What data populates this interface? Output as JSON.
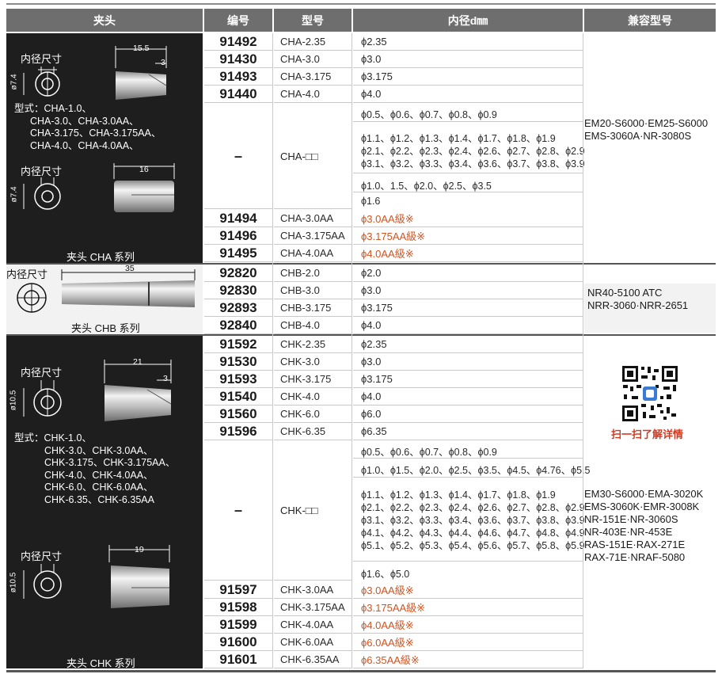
{
  "headers": {
    "collet": "夹头",
    "number": "编号",
    "model": "型号",
    "diameter": "内径d㎜",
    "compatible": "兼容型号"
  },
  "placeholder_dash": "–",
  "cha": {
    "inner_label": "内径尺寸",
    "dim_phi": "ø7.4",
    "dim_length_top": "15.5",
    "dim_small": "3",
    "dim_length_bottom": "16",
    "types_lines": [
      "型式：CHA-1.0、",
      "CHA-3.0、CHA-3.0AA、",
      "CHA-3.175、CHA-3.175AA、",
      "CHA-4.0、CHA-4.0AA、"
    ],
    "series": "夹头 CHA 系列",
    "rows_top": [
      {
        "num": "91492",
        "model": "CHA-2.35",
        "dia": "ϕ2.35"
      },
      {
        "num": "91430",
        "model": "CHA-3.0",
        "dia": "ϕ3.0"
      },
      {
        "num": "91493",
        "model": "CHA-3.175",
        "dia": "ϕ3.175"
      },
      {
        "num": "91440",
        "model": "CHA-4.0",
        "dia": "ϕ4.0"
      }
    ],
    "generic_model": "CHA-□□",
    "generic_lines": [
      "ϕ0.5、ϕ0.6、ϕ0.7、ϕ0.8、ϕ0.9",
      "ϕ1.1、ϕ1.2、ϕ1.3、ϕ1.4、ϕ1.7、ϕ1.8、ϕ1.9",
      "ϕ2.1、ϕ2.2、ϕ2.3、ϕ2.4、ϕ2.6、ϕ2.7、ϕ2.8、ϕ2.9",
      "ϕ3.1、ϕ3.2、ϕ3.3、ϕ3.4、ϕ3.6、ϕ3.7、ϕ3.8、ϕ3.9",
      "ϕ1.0、1.5、ϕ2.0、ϕ2.5、ϕ3.5",
      "ϕ1.6"
    ],
    "rows_aa": [
      {
        "num": "91494",
        "model": "CHA-3.0AA",
        "dia": "ϕ3.0AA級※"
      },
      {
        "num": "91496",
        "model": "CHA-3.175AA",
        "dia": "ϕ3.175AA級※"
      },
      {
        "num": "91495",
        "model": "CHA-4.0AA",
        "dia": "ϕ4.0AA級※"
      }
    ],
    "compatible": [
      "EM20-S6000·EM25-S6000",
      "EMS-3060A·NR-3080S"
    ]
  },
  "chb": {
    "inner_label": "内径尺寸",
    "dim_length": "35",
    "series": "夹头 CHB 系列",
    "rows": [
      {
        "num": "92820",
        "model": "CHB-2.0",
        "dia": "ϕ2.0"
      },
      {
        "num": "92830",
        "model": "CHB-3.0",
        "dia": "ϕ3.0"
      },
      {
        "num": "92893",
        "model": "CHB-3.175",
        "dia": "ϕ3.175"
      },
      {
        "num": "92840",
        "model": "CHB-4.0",
        "dia": "ϕ4.0"
      }
    ],
    "compatible": [
      "NR40-5100  ATC",
      "NRR-3060·NRR-2651"
    ]
  },
  "chk": {
    "inner_label": "内径尺寸",
    "dim_phi": "ø10.5",
    "dim_length_top": "21",
    "dim_small": "3",
    "dim_length_bottom": "19",
    "types_lines": [
      "型式：CHK-1.0、",
      "CHK-3.0、CHK-3.0AA、",
      "CHK-3.175、CHK-3.175AA、",
      "CHK-4.0、CHK-4.0AA、",
      "CHK-6.0、CHK-6.0AA、",
      "CHK-6.35、CHK-6.35AA"
    ],
    "series": "夹头 CHK 系列",
    "rows_top": [
      {
        "num": "91592",
        "model": "CHK-2.35",
        "dia": "ϕ2.35"
      },
      {
        "num": "91530",
        "model": "CHK-3.0",
        "dia": "ϕ3.0"
      },
      {
        "num": "91593",
        "model": "CHK-3.175",
        "dia": "ϕ3.175"
      },
      {
        "num": "91540",
        "model": "CHK-4.0",
        "dia": "ϕ4.0"
      },
      {
        "num": "91560",
        "model": "CHK-6.0",
        "dia": "ϕ6.0"
      },
      {
        "num": "91596",
        "model": "CHK-6.35",
        "dia": "ϕ6.35"
      }
    ],
    "generic_model": "CHK-□□",
    "generic_lines": [
      "ϕ0.5、ϕ0.6、ϕ0.7、ϕ0.8、ϕ0.9",
      "ϕ1.0、ϕ1.5、ϕ2.0、ϕ2.5、ϕ3.5、ϕ4.5、ϕ4.76、ϕ5.5",
      "ϕ1.1、ϕ1.2、ϕ1.3、ϕ1.4、ϕ1.7、ϕ1.8、ϕ1.9",
      "ϕ2.1、ϕ2.2、ϕ2.3、ϕ2.4、ϕ2.6、ϕ2.7、ϕ2.8、ϕ2.9",
      "ϕ3.1、ϕ3.2、ϕ3.3、ϕ3.4、ϕ3.6、ϕ3.7、ϕ3.8、ϕ3.9",
      "ϕ4.1、ϕ4.2、ϕ4.3、ϕ4.4、ϕ4.6、ϕ4.7、ϕ4.8、ϕ4.9",
      "ϕ5.1、ϕ5.2、ϕ5.3、ϕ5.4、ϕ5.6、ϕ5.7、ϕ5.8、ϕ5.9",
      "ϕ1.6、ϕ5.0"
    ],
    "rows_aa": [
      {
        "num": "91597",
        "model": "CHK-3.0AA",
        "dia": "ϕ3.0AA級※"
      },
      {
        "num": "91598",
        "model": "CHK-3.175AA",
        "dia": "ϕ3.175AA級※"
      },
      {
        "num": "91599",
        "model": "CHK-4.0AA",
        "dia": "ϕ4.0AA級※"
      },
      {
        "num": "91600",
        "model": "CHK-6.0AA",
        "dia": "ϕ6.0AA級※"
      },
      {
        "num": "91601",
        "model": "CHK-6.35AA",
        "dia": "ϕ6.35AA級※"
      }
    ],
    "qr_caption": "扫一扫了解详情",
    "compatible": [
      "EM30-S6000·EMA-3020K",
      "EMS-3060K·EMR-3008K",
      "NR-151E·NR-3060S",
      "NR-403E·NR-453E",
      "RAS-151E·RAX-271E",
      "RAX-71E·NRAF-5080"
    ]
  },
  "colors": {
    "header_bg": "#6e6e6e",
    "dark_panel": "#1e1e1e",
    "light_panel": "#f2f2f2",
    "aa_orange": "#d2531f",
    "qr_red": "#d23b1f"
  }
}
